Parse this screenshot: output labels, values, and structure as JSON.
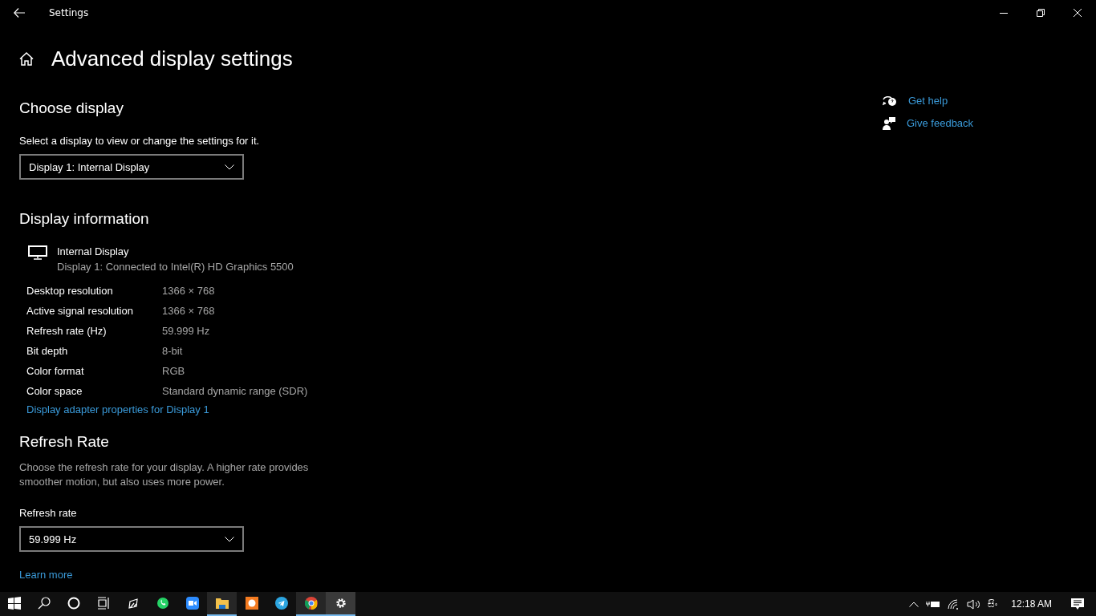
{
  "window": {
    "title": "Settings"
  },
  "page": {
    "title": "Advanced display settings"
  },
  "choose_display": {
    "heading": "Choose display",
    "label": "Select a display to view or change the settings for it.",
    "dropdown": {
      "value": "Display 1: Internal Display"
    }
  },
  "display_information": {
    "heading": "Display information",
    "display_name": "Internal Display",
    "display_detail": "Display 1: Connected to Intel(R) HD Graphics 5500",
    "rows": [
      {
        "label": "Desktop resolution",
        "value": "1366 × 768"
      },
      {
        "label": "Active signal resolution",
        "value": "1366 × 768"
      },
      {
        "label": "Refresh rate (Hz)",
        "value": "59.999 Hz"
      },
      {
        "label": "Bit depth",
        "value": "8-bit"
      },
      {
        "label": "Color format",
        "value": "RGB"
      },
      {
        "label": "Color space",
        "value": "Standard dynamic range (SDR)"
      }
    ],
    "link": "Display adapter properties for Display 1"
  },
  "refresh_rate": {
    "heading": "Refresh Rate",
    "description": "Choose the refresh rate for your display. A higher rate provides smoother motion, but also uses more power.",
    "label": "Refresh rate",
    "dropdown": {
      "value": "59.999 Hz"
    },
    "link": "Learn more"
  },
  "help_links": [
    {
      "kind": "help",
      "label": "Get help"
    },
    {
      "kind": "feedback",
      "label": "Give feedback"
    }
  ],
  "taskbar": {
    "apps": [
      {
        "kind": "start",
        "running": false,
        "selected": false
      },
      {
        "kind": "search",
        "running": false,
        "selected": false
      },
      {
        "kind": "cortana",
        "running": false,
        "selected": false
      },
      {
        "kind": "taskview",
        "running": false,
        "selected": false
      },
      {
        "kind": "pen",
        "running": false,
        "selected": false
      },
      {
        "kind": "chat",
        "running": false,
        "selected": false
      },
      {
        "kind": "video",
        "running": false,
        "selected": false
      },
      {
        "kind": "folder",
        "running": true,
        "selected": false
      },
      {
        "kind": "capture",
        "running": false,
        "selected": false
      },
      {
        "kind": "plane",
        "running": false,
        "selected": false
      },
      {
        "kind": "browser",
        "running": true,
        "selected": false
      },
      {
        "kind": "settings",
        "running": true,
        "selected": true
      }
    ],
    "language": "සිං",
    "time": "12:18 AM"
  }
}
